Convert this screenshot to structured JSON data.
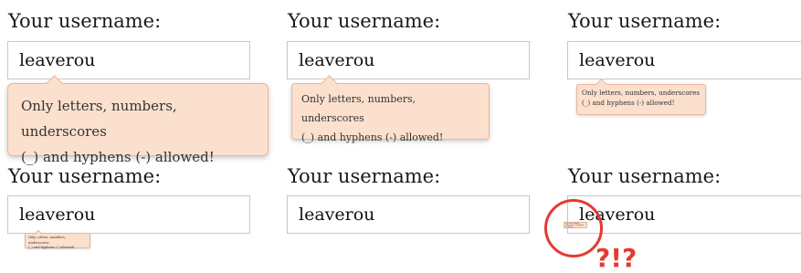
{
  "label": "Your username:",
  "value": "leaverou",
  "tooltip": "Only letters, numbers, underscores (_) and hyphens (-) allowed!",
  "tooltip_line1": "Only letters, numbers, underscores",
  "tooltip_line2": "(_) and hyphens (-) allowed!",
  "annotation": "?!?",
  "colors": {
    "tooltip_bg": "#fbe0cd",
    "tooltip_border": "#e7b89e",
    "annotation": "#e53a2f"
  }
}
